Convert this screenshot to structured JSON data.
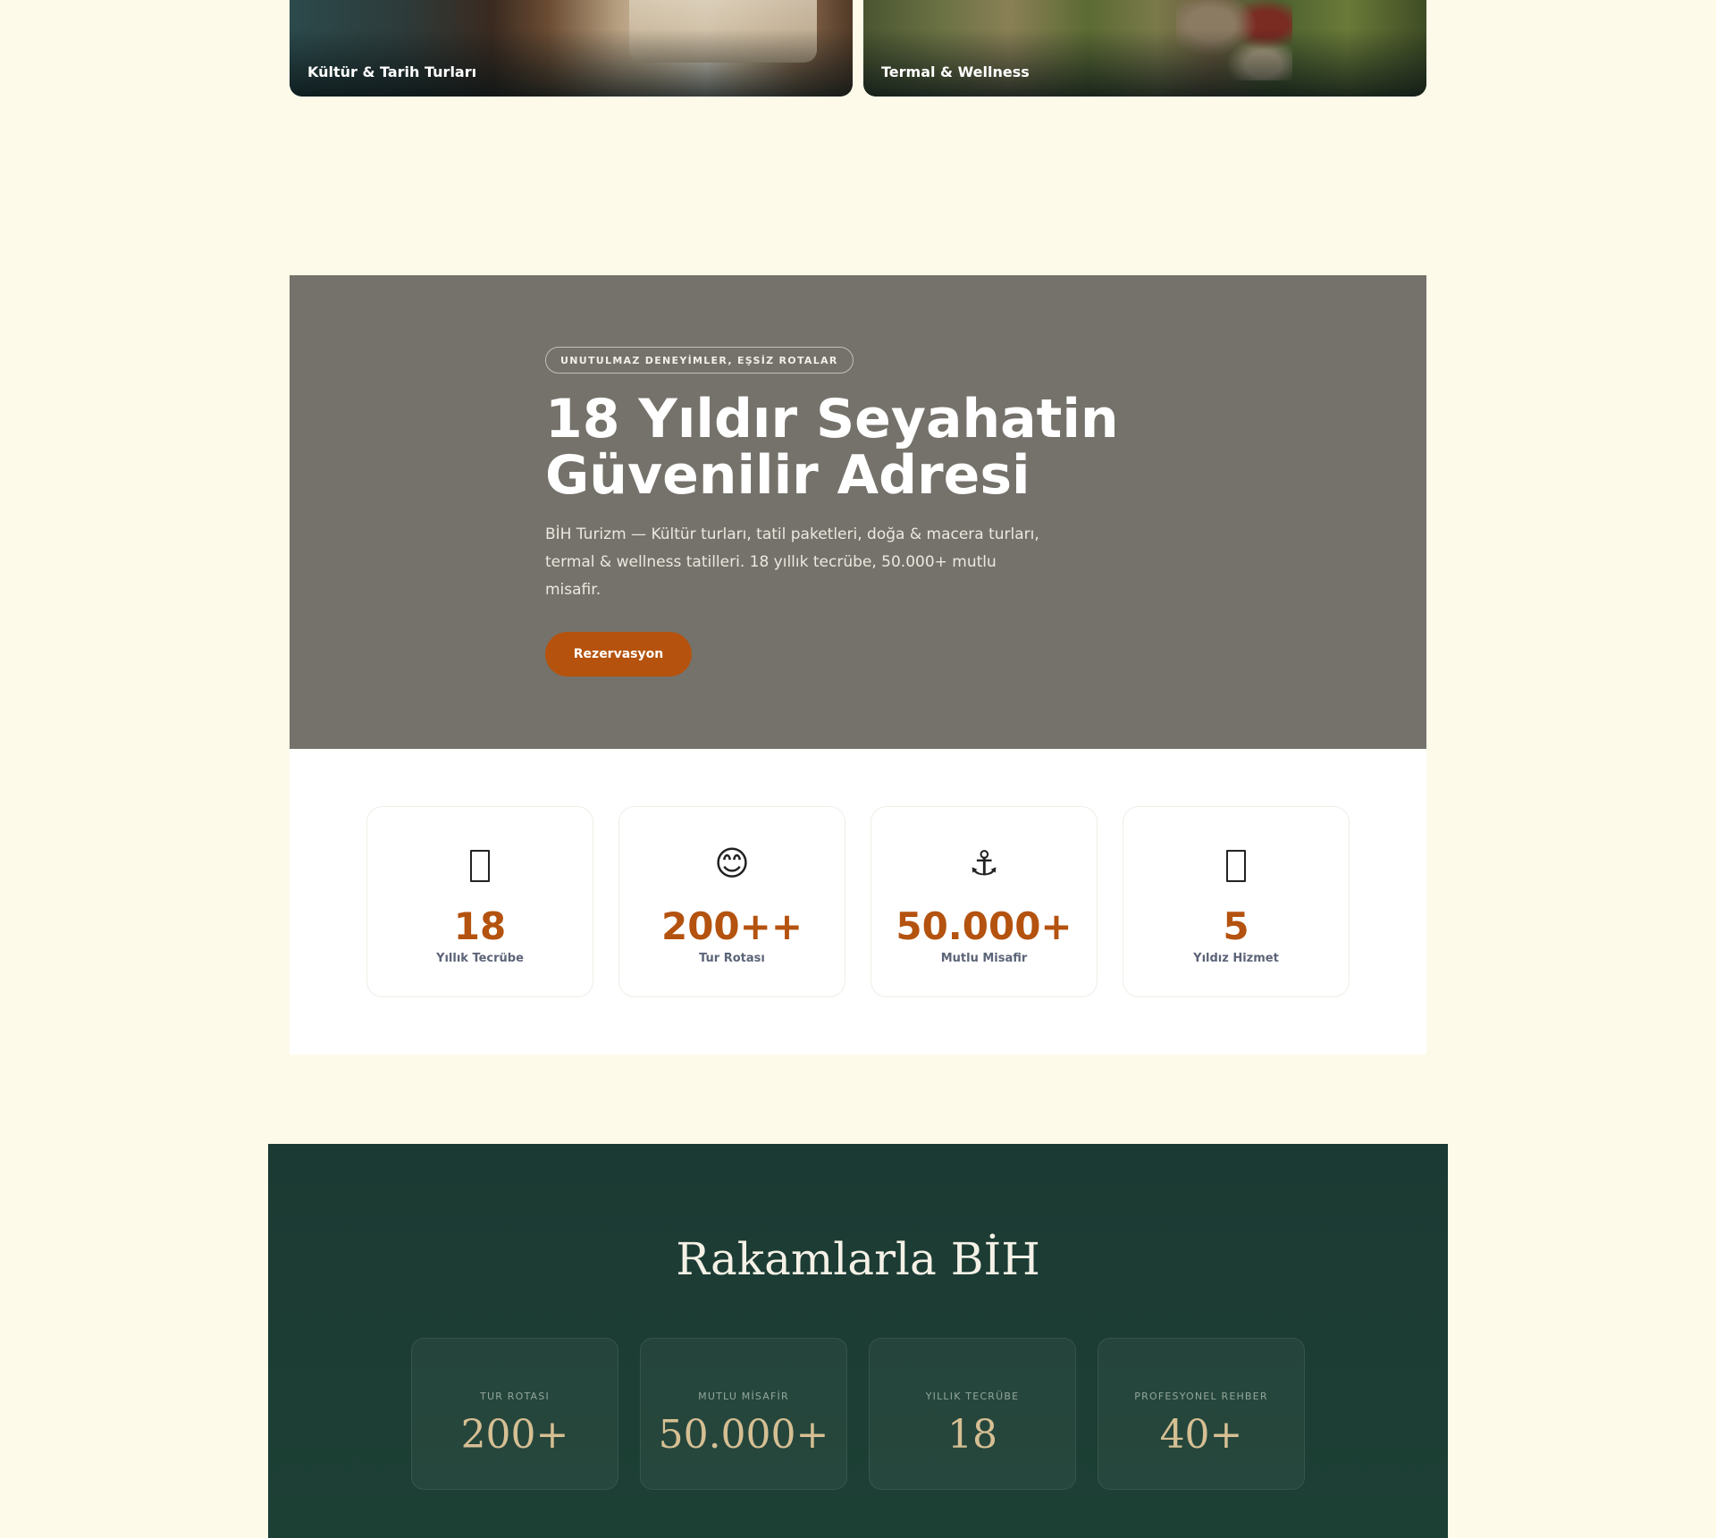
{
  "categories": [
    {
      "label": "Kültür & Tarih Turları"
    },
    {
      "label": "Termal & Wellness"
    }
  ],
  "hero": {
    "badge": "UNUTULMAZ DENEYİMLER, EŞSİZ ROTALAR",
    "title_line1": "18 Yıldır Seyahatin",
    "title_line2": "Güvenilir Adresi",
    "description": "BİH Turizm — Kültür turları, tatil paketleri, doğa & macera turları, termal & wellness tatilleri. 18 yıllık tecrübe, 50.000+ mutlu misafir.",
    "button": "Rezervasyon"
  },
  "stats": [
    {
      "icon": "missing-glyph-icon",
      "value": "18",
      "label": "Yıllık Tecrübe"
    },
    {
      "icon": "smiling-face-icon",
      "glyph": "😊",
      "value": "200++",
      "label": "Tur Rotası"
    },
    {
      "icon": "anchor-icon",
      "glyph": "⚓",
      "value": "50.000+",
      "label": "Mutlu Misafir"
    },
    {
      "icon": "missing-glyph-icon",
      "value": "5",
      "label": "Yıldız Hizmet"
    }
  ],
  "numbers": {
    "title": "Rakamlarla BİH",
    "items": [
      {
        "label": "TUR ROTASI",
        "value": "200+"
      },
      {
        "label": "MUTLU MİSAFİR",
        "value": "50.000+"
      },
      {
        "label": "YILLIK TECRÜBE",
        "value": "18"
      },
      {
        "label": "PROFESYONEL REHBER",
        "value": "40+"
      }
    ]
  },
  "colors": {
    "page_bg": "#fefae9",
    "hero_bg": "#75726b",
    "accent": "#b5520d",
    "green_bg": "#1b3a33",
    "gold": "#d6bf93"
  }
}
